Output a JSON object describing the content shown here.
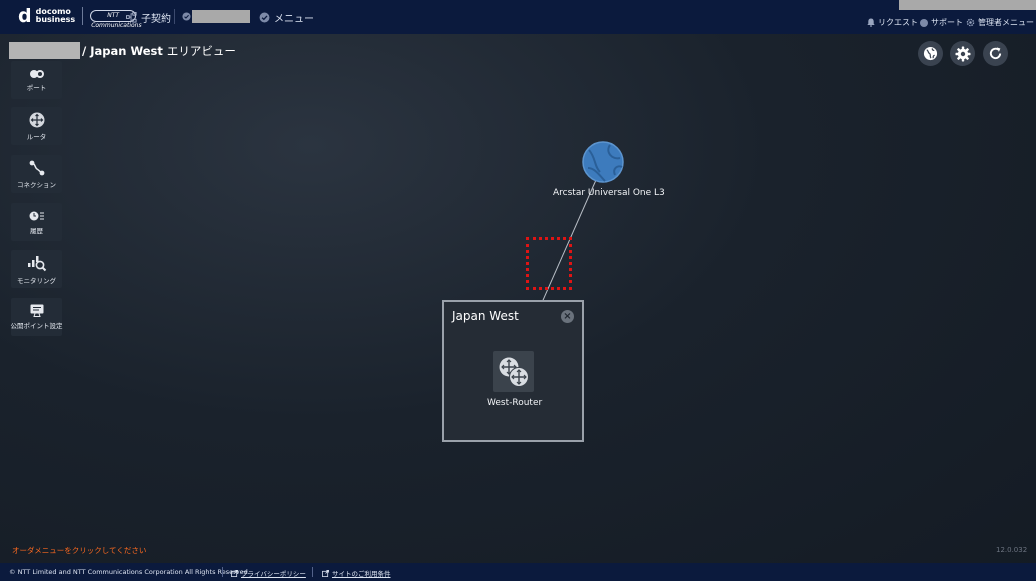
{
  "header": {
    "logo_main": "d",
    "logo_line1": "docomo",
    "logo_line2": "business",
    "logo_ntt": "NTT Communications",
    "contract_label": "子契約",
    "menu_label": "メニュー",
    "request_label": "リクエスト",
    "support_label": "サポート",
    "admin_menu_label": "管理者メニュー"
  },
  "breadcrumb": {
    "separator": "/ ",
    "area_name": "Japan West",
    "view_label": "エリアビュー"
  },
  "sidebar": {
    "items": [
      {
        "label": "ポート",
        "icon": "port-icon"
      },
      {
        "label": "ルータ",
        "icon": "router-icon"
      },
      {
        "label": "コネクション",
        "icon": "connection-icon"
      },
      {
        "label": "履歴",
        "icon": "history-icon"
      },
      {
        "label": "モニタリング",
        "icon": "monitoring-icon"
      },
      {
        "label": "公開ポイント設定",
        "icon": "public-point-icon"
      }
    ]
  },
  "toolbar": {
    "buttons": [
      {
        "icon": "globe-icon"
      },
      {
        "icon": "gear-icon"
      },
      {
        "icon": "refresh-icon"
      }
    ]
  },
  "diagram": {
    "internet_node_label": "Arcstar Universal One L3",
    "area_title": "Japan West",
    "close_symbol": "×",
    "router_label": "West-Router"
  },
  "status": {
    "order_message": "オーダメニューをクリックしてください",
    "version": "12.0.032"
  },
  "footer": {
    "copyright": "© NTT Limited and NTT Communications Corporation All Rights Reserved.",
    "privacy_link": "プライバシーポリシー",
    "terms_link": "サイトのご利用条件"
  },
  "colors": {
    "header_bg": "#0b1a3d",
    "canvas_bg": "#1a222c",
    "globe_node": "#3f7fc0",
    "highlight": "#e01414",
    "order_msg": "#ff6a1f"
  }
}
